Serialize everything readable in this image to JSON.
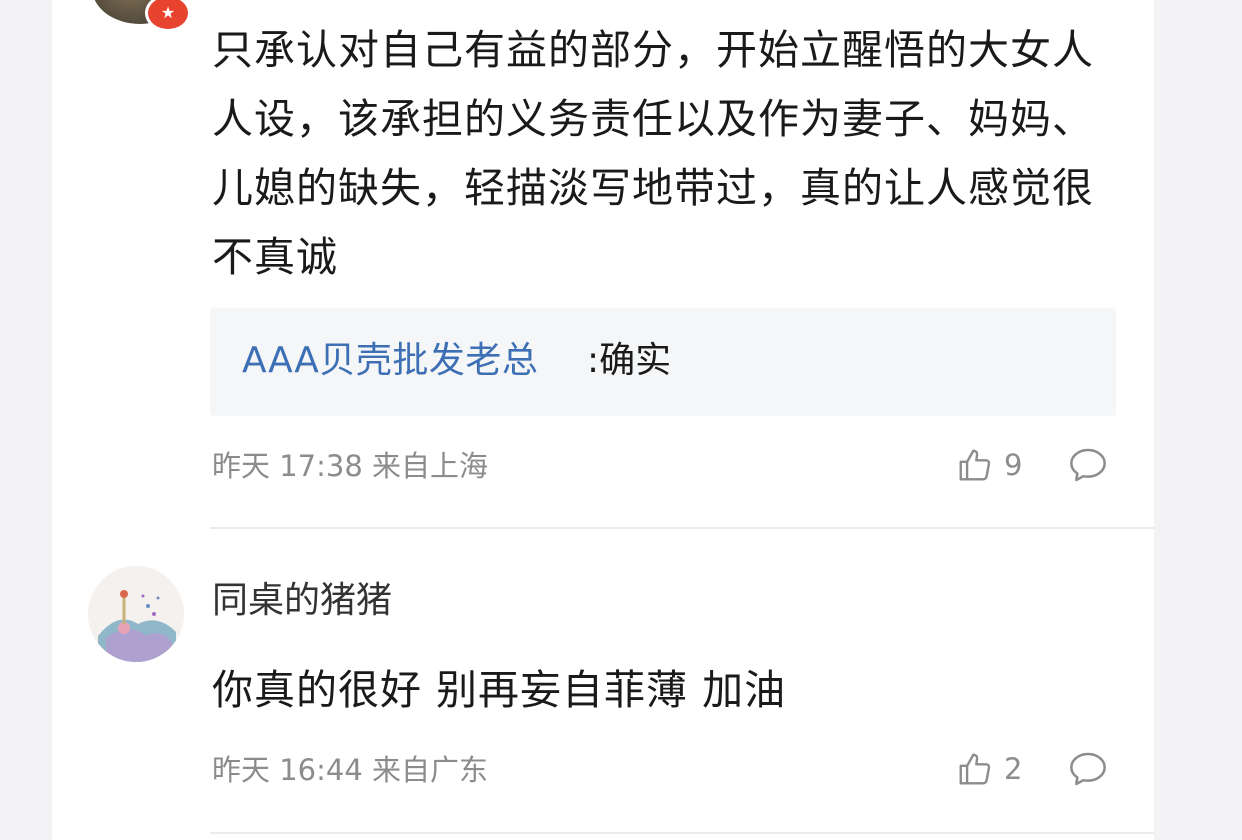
{
  "comments": [
    {
      "text": "只承认对自己有益的部分，开始立醒悟的大女人人设，该承担的义务责任以及作为妻子、妈妈、儿媳的缺失，轻描淡写地带过，真的让人感觉很不真诚",
      "reply": {
        "author": "AAA贝壳批发老总",
        "text": ":确实"
      },
      "time": "昨天 17:38 来自上海",
      "likes": "9"
    },
    {
      "username": "同桌的猪猪",
      "text": "你真的很好 别再妄自菲薄 加油",
      "time": "昨天 16:44 来自广东",
      "likes": "2"
    }
  ],
  "icons": {
    "like": "thumbs-up-icon",
    "reply": "comment-bubble-icon",
    "badge": "star-badge-icon"
  },
  "colors": {
    "link": "#3d6fb5",
    "meta": "#8c8c8c",
    "badge": "#e8432e"
  }
}
